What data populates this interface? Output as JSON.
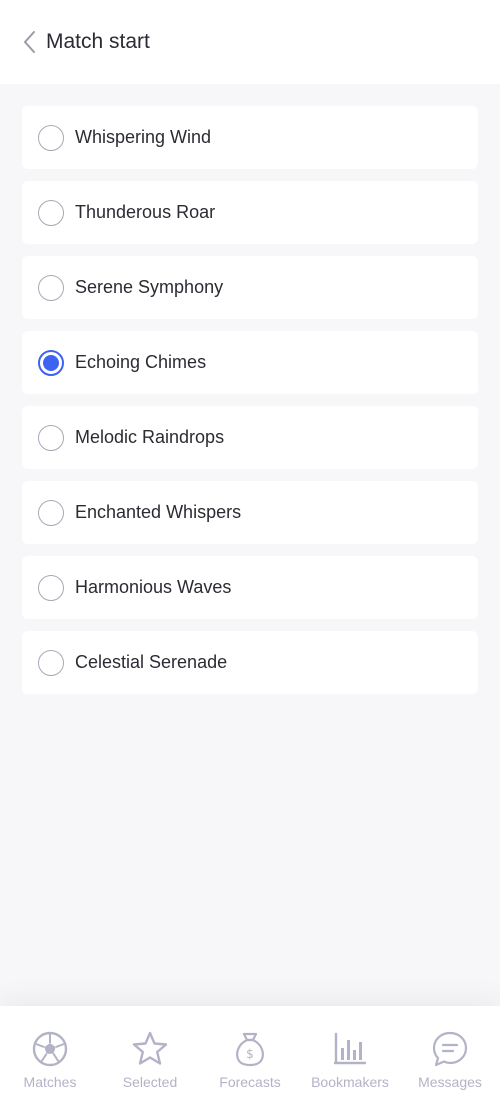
{
  "header": {
    "title": "Match start",
    "back_icon": "chevron-left-icon"
  },
  "options": [
    {
      "label": "Whispering Wind",
      "selected": false
    },
    {
      "label": "Thunderous Roar",
      "selected": false
    },
    {
      "label": "Serene Symphony",
      "selected": false
    },
    {
      "label": "Echoing Chimes",
      "selected": true
    },
    {
      "label": "Melodic Raindrops",
      "selected": false
    },
    {
      "label": "Enchanted Whispers",
      "selected": false
    },
    {
      "label": "Harmonious Waves",
      "selected": false
    },
    {
      "label": "Celestial Serenade",
      "selected": false
    }
  ],
  "tabs": [
    {
      "label": "Matches",
      "icon": "soccer-ball-icon"
    },
    {
      "label": "Selected",
      "icon": "star-icon"
    },
    {
      "label": "Forecasts",
      "icon": "money-bag-icon"
    },
    {
      "label": "Bookmakers",
      "icon": "bar-chart-icon"
    },
    {
      "label": "Messages",
      "icon": "chat-bubble-icon"
    }
  ],
  "colors": {
    "accent": "#3d63f2",
    "tab_inactive": "#b3b3c8",
    "background": "#f7f7fa"
  }
}
